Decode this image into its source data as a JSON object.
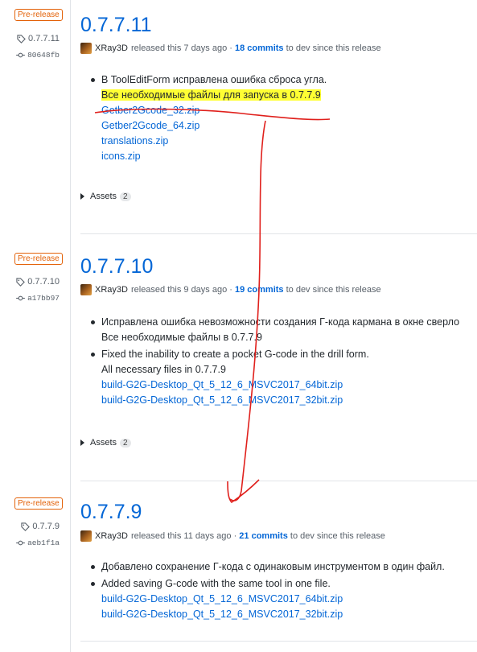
{
  "releases": [
    {
      "badge": "Pre-release",
      "tag": "0.7.7.11",
      "commit": "80648fb",
      "title": "0.7.7.11",
      "author": "XRay3D",
      "released": "released this 7 days ago ·",
      "commits": "18 commits",
      "since": "to dev since this release",
      "items": [
        {
          "bullet": "В ToolEditForm исправлена ошибка сброса угла.",
          "cont": "Все необходимые файлы для запуска в 0.7.7.9"
        }
      ],
      "links": [
        "Getber2Gcode_32.zip",
        "Getber2Gcode_64.zip",
        "translations.zip",
        "icons.zip"
      ],
      "assets_label": "Assets",
      "assets_count": "2"
    },
    {
      "badge": "Pre-release",
      "tag": "0.7.7.10",
      "commit": "a17bb97",
      "title": "0.7.7.10",
      "author": "XRay3D",
      "released": "released this 9 days ago ·",
      "commits": "19 commits",
      "since": "to dev since this release",
      "items": [
        {
          "bullet": "Исправлена ошибка невозможности создания Г-кода кармана в окне сверло",
          "cont": "Все необходимые файлы в 0.7.7.9"
        },
        {
          "bullet": "Fixed the inability to create a pocket G-code in the drill form.",
          "cont": "All necessary files in 0.7.7.9"
        }
      ],
      "links": [
        "build-G2G-Desktop_Qt_5_12_6_MSVC2017_64bit.zip",
        "build-G2G-Desktop_Qt_5_12_6_MSVC2017_32bit.zip"
      ],
      "assets_label": "Assets",
      "assets_count": "2"
    },
    {
      "badge": "Pre-release",
      "tag": "0.7.7.9",
      "commit": "aeb1f1a",
      "title": "0.7.7.9",
      "author": "XRay3D",
      "released": "released this 11 days ago ·",
      "commits": "21 commits",
      "since": "to dev since this release",
      "items": [
        {
          "bullet": "Добавлено сохранение Г-кода с одинаковым инструментом в один файл.",
          "cont": ""
        },
        {
          "bullet": "Added saving G-code with the same tool in one file.",
          "cont": ""
        }
      ],
      "links": [
        "build-G2G-Desktop_Qt_5_12_6_MSVC2017_64bit.zip",
        "build-G2G-Desktop_Qt_5_12_6_MSVC2017_32bit.zip"
      ]
    }
  ],
  "colors": {
    "link": "#0366d6",
    "prerelease": "#e36209",
    "highlight": "#ffff33",
    "annotation": "#e0201c"
  },
  "icons": {
    "tag": "tag-icon",
    "commit": "commit-icon",
    "expand": "triangle-right-icon"
  }
}
